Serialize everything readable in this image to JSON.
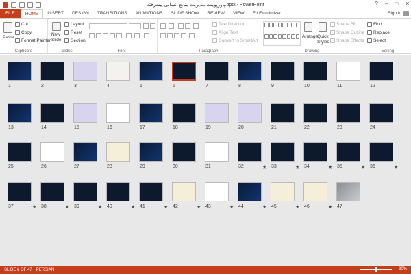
{
  "window": {
    "title": "پاورپوینت مدیریت منابع انسانی پیشرفته.pptx - PowerPoint",
    "controls": {
      "help": "?",
      "minimize": "–",
      "maximize": "□",
      "close": "✕"
    }
  },
  "ribbon_tabs": [
    "FILE",
    "HOME",
    "INSERT",
    "DESIGN",
    "TRANSITIONS",
    "ANIMATIONS",
    "SLIDE SHOW",
    "REVIEW",
    "VIEW",
    "FILEminimizer"
  ],
  "active_tab": "HOME",
  "sign_in": "Sign in",
  "clipboard": {
    "paste": "Paste",
    "cut": "Cut",
    "copy": "Copy",
    "format_painter": "Format Painter",
    "label": "Clipboard"
  },
  "slides_group": {
    "new_slide": "New",
    "new_slide2": "Slide",
    "layout": "Layout",
    "reset": "Reset",
    "section": "Section",
    "label": "Slides"
  },
  "font_group": {
    "label": "Font"
  },
  "paragraph_group": {
    "text_direction": "Text Direction",
    "align_text": "Align Text",
    "convert_smartart": "Convert to SmartArt",
    "label": "Paragraph"
  },
  "drawing_group": {
    "arrange": "Arrange",
    "quick_styles": "Quick",
    "quick_styles2": "Styles",
    "shape_fill": "Shape Fill",
    "shape_outline": "Shape Outline",
    "shape_effects": "Shape Effects",
    "label": "Drawing"
  },
  "editing_group": {
    "find": "Find",
    "replace": "Replace",
    "select": "Select",
    "label": "Editing"
  },
  "slides": [
    {
      "num": "1",
      "theme": "dark1",
      "star": false
    },
    {
      "num": "2",
      "theme": "dark2",
      "star": false
    },
    {
      "num": "3",
      "theme": "lav",
      "star": false
    },
    {
      "num": "4",
      "theme": "light",
      "star": false
    },
    {
      "num": "5",
      "theme": "dark1",
      "star": false
    },
    {
      "num": "6",
      "theme": "dark2",
      "star": false,
      "selected": true
    },
    {
      "num": "7",
      "theme": "dark2",
      "star": false
    },
    {
      "num": "8",
      "theme": "dark1",
      "star": false
    },
    {
      "num": "9",
      "theme": "dark2",
      "star": false
    },
    {
      "num": "10",
      "theme": "dark2",
      "star": false
    },
    {
      "num": "11",
      "theme": "white",
      "star": false
    },
    {
      "num": "12",
      "theme": "dark2",
      "star": false
    },
    {
      "num": "13",
      "theme": "dark1",
      "star": false
    },
    {
      "num": "14",
      "theme": "dark2",
      "star": false
    },
    {
      "num": "15",
      "theme": "lav",
      "star": false
    },
    {
      "num": "16",
      "theme": "white",
      "star": false
    },
    {
      "num": "17",
      "theme": "dark1",
      "star": false
    },
    {
      "num": "18",
      "theme": "dark2",
      "star": false
    },
    {
      "num": "19",
      "theme": "lav",
      "star": false
    },
    {
      "num": "20",
      "theme": "lav",
      "star": false
    },
    {
      "num": "21",
      "theme": "dark2",
      "star": false
    },
    {
      "num": "22",
      "theme": "dark2",
      "star": false
    },
    {
      "num": "23",
      "theme": "dark2",
      "star": false
    },
    {
      "num": "24",
      "theme": "dark2",
      "star": false
    },
    {
      "num": "25",
      "theme": "dark2",
      "star": false
    },
    {
      "num": "26",
      "theme": "white",
      "star": false
    },
    {
      "num": "27",
      "theme": "dark1",
      "star": false
    },
    {
      "num": "28",
      "theme": "cream",
      "star": false
    },
    {
      "num": "29",
      "theme": "dark1",
      "star": false
    },
    {
      "num": "30",
      "theme": "dark2",
      "star": false
    },
    {
      "num": "31",
      "theme": "white",
      "star": false
    },
    {
      "num": "32",
      "theme": "dark2",
      "star": true
    },
    {
      "num": "33",
      "theme": "dark2",
      "star": true
    },
    {
      "num": "34",
      "theme": "dark2",
      "star": true
    },
    {
      "num": "35",
      "theme": "dark2",
      "star": true
    },
    {
      "num": "36",
      "theme": "dark2",
      "star": true
    },
    {
      "num": "37",
      "theme": "dark2",
      "star": true
    },
    {
      "num": "38",
      "theme": "dark2",
      "star": true
    },
    {
      "num": "39",
      "theme": "dark2",
      "star": true
    },
    {
      "num": "40",
      "theme": "dark2",
      "star": true
    },
    {
      "num": "41",
      "theme": "dark2",
      "star": true
    },
    {
      "num": "42",
      "theme": "cream",
      "star": true
    },
    {
      "num": "43",
      "theme": "white",
      "star": true
    },
    {
      "num": "44",
      "theme": "dark1",
      "star": true
    },
    {
      "num": "45",
      "theme": "cream",
      "star": true
    },
    {
      "num": "46",
      "theme": "cream",
      "star": true
    },
    {
      "num": "47",
      "theme": "photo",
      "star": false
    }
  ],
  "star_glyph": "★",
  "status": {
    "slide_info": "SLIDE 6 OF 47",
    "language": "PERSIAN",
    "zoom": "30%"
  },
  "colors": {
    "accent": "#c43e1c"
  }
}
